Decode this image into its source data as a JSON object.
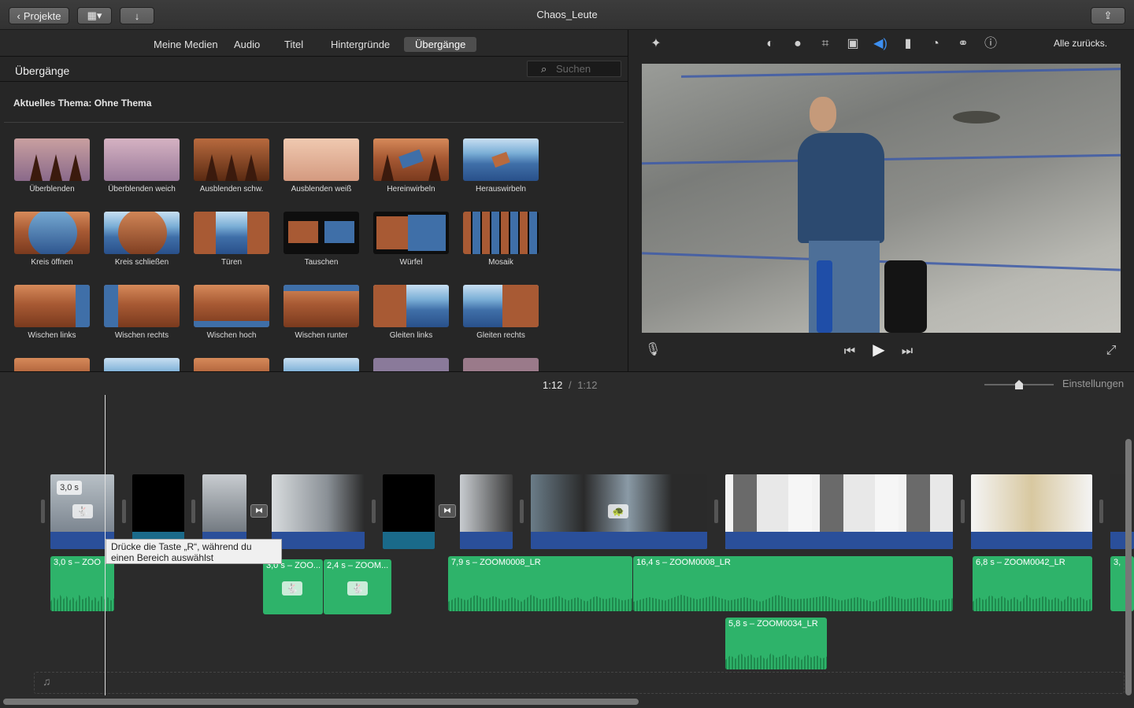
{
  "toolbar": {
    "projects_label": "Projekte",
    "title": "Chaos_Leute"
  },
  "browser": {
    "tabs": [
      "Meine Medien",
      "Audio",
      "Titel",
      "Hintergründe",
      "Übergänge"
    ],
    "selected_tab": "Übergänge",
    "section_title": "Übergänge",
    "search_placeholder": "Suchen",
    "theme_label": "Aktuelles Thema: Ohne Thema",
    "transitions": [
      "Überblenden",
      "Überblenden weich",
      "Ausblenden schw.",
      "Ausblenden weiß",
      "Hereinwirbeln",
      "Herauswirbeln",
      "Kreis öffnen",
      "Kreis schließen",
      "Türen",
      "Tauschen",
      "Würfel",
      "Mosaik",
      "Wischen links",
      "Wischen rechts",
      "Wischen hoch",
      "Wischen runter",
      "Gleiten links",
      "Gleiten rechts"
    ]
  },
  "viewer": {
    "reset_all_label": "Alle zurücks.",
    "icons": [
      "magic-wand-icon",
      "color-balance-icon",
      "color-palette-icon",
      "crop-icon",
      "stabilization-icon",
      "volume-icon",
      "equalizer-icon",
      "speed-icon",
      "overlay-icon",
      "info-icon"
    ]
  },
  "timeline": {
    "current_time": "1:12",
    "separator": "/",
    "total_time": "1:12",
    "settings_label": "Einstellungen",
    "tooltip": "Drücke die Taste „R“, während du einen Bereich auswählst",
    "clip_badge": "3,0 s",
    "audio_clips": [
      "3,0 s – ZOO",
      "3,0 s – ZOO...",
      "2,4 s – ZOOM...",
      "7,9 s – ZOOM0008_LR",
      "16,4 s – ZOOM0008_LR",
      "5,8 s – ZOOM0034_LR",
      "6,8 s – ZOOM0042_LR",
      "3,"
    ]
  },
  "colors": {
    "accent": "#2eb36a",
    "clip_blue": "#2a4f9a",
    "audio_green": "#2eb36a"
  }
}
